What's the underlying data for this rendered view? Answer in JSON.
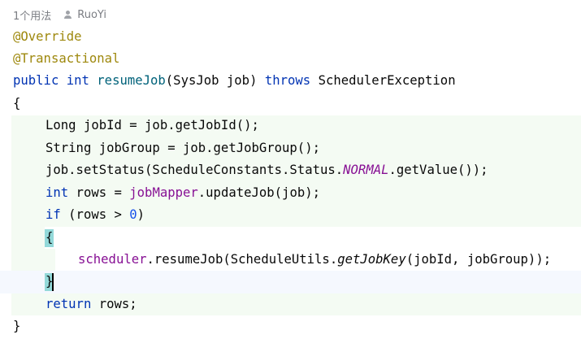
{
  "inlay_hint": {
    "usages": "1个用法",
    "author": "RuoYi",
    "author_icon": "user-icon"
  },
  "code": {
    "l1": "@Override",
    "l2": "@Transactional",
    "l3": [
      "public",
      "int",
      "resumeJob",
      "(SysJob job) ",
      "throws",
      " SchedulerException"
    ],
    "l4": "{",
    "l5": "Long jobId = job.getJobId();",
    "l6": "String jobGroup = job.getJobGroup();",
    "l7": [
      "job.setStatus(ScheduleConstants.Status.",
      "NORMAL",
      ".getValue());"
    ],
    "l8": [
      "int",
      " rows = ",
      "jobMapper",
      ".updateJob(job);"
    ],
    "l9": [
      "if",
      " (rows > ",
      "0",
      ")"
    ],
    "l10": "{",
    "l11": [
      "scheduler",
      ".resumeJob(ScheduleUtils.",
      "getJobKey",
      "(jobId, jobGroup));"
    ],
    "l12": "}",
    "l13": [
      "return",
      " rows;"
    ],
    "l14": "}"
  },
  "colors": {
    "keyword": "#0033b3",
    "annotation": "#9e880d",
    "method_declaration": "#00627a",
    "field": "#871094",
    "number": "#1750eb",
    "brace_highlight": "#93d9d9"
  }
}
